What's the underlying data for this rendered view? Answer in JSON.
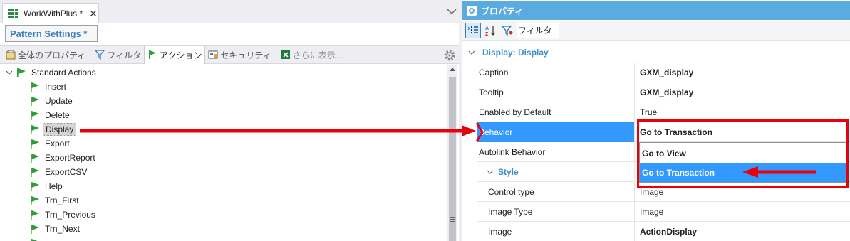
{
  "left_pane": {
    "tab": {
      "title": "WorkWithPlus *",
      "close_glyph": "✕"
    },
    "pattern_settings_label": "Pattern Settings *",
    "toolbar": [
      {
        "label": "全体のプロパティ",
        "icon": "properties-icon"
      },
      {
        "label": "フィルタ",
        "icon": "filter-icon"
      },
      {
        "label": "アクション",
        "icon": "flag-icon"
      },
      {
        "label": "セキュリティ",
        "icon": "security-icon"
      },
      {
        "label": "さらに表示…",
        "icon": "excel-icon"
      }
    ],
    "tree": {
      "root": "Standard Actions",
      "items": [
        "Insert",
        "Update",
        "Delete",
        "Display",
        "Export",
        "ExportReport",
        "ExportCSV",
        "Help",
        "Trn_First",
        "Trn_Previous",
        "Trn_Next"
      ],
      "selected": "Display"
    }
  },
  "properties": {
    "title": "プロパティ",
    "filter_label": "フィルタ",
    "category": "Display: Display",
    "rows": [
      {
        "name": "Caption",
        "value": "GXM_display",
        "bold": true
      },
      {
        "name": "Tooltip",
        "value": "GXM_display",
        "bold": true
      },
      {
        "name": "Enabled by Default",
        "value": "True",
        "bold": false
      },
      {
        "name": "Behavior",
        "value": "Go to Transaction",
        "bold": true
      },
      {
        "name": "Autolink Behavior",
        "value": "",
        "bold": false
      }
    ],
    "style_group": "Style",
    "style_rows": [
      {
        "name": "Control type",
        "value": "Image",
        "bold": false
      },
      {
        "name": "Image Type",
        "value": "Image",
        "bold": false
      },
      {
        "name": "Image",
        "value": "ActionDisplay",
        "bold": true
      }
    ],
    "dropdown_options": [
      "Go to View",
      "Go to Transaction"
    ],
    "dropdown_highlighted": "Go to Transaction"
  },
  "colors": {
    "accent_blue": "#5aabdf",
    "selection_blue": "#3399ff",
    "category_blue": "#3c8fce",
    "annotation_red": "#e8000b",
    "flag_green": "#2e9e3a"
  }
}
